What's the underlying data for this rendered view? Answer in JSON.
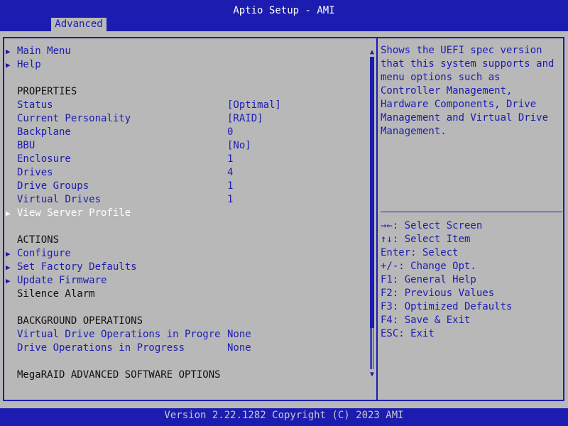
{
  "app_title": "Aptio Setup - AMI",
  "tab": "Advanced",
  "menu": {
    "main_menu": "Main Menu",
    "help": "Help",
    "properties_heading": "PROPERTIES",
    "status": {
      "label": "Status",
      "value": "[Optimal]"
    },
    "personality": {
      "label": "Current Personality",
      "value": "[RAID]"
    },
    "backplane": {
      "label": "Backplane",
      "value": "0"
    },
    "bbu": {
      "label": "BBU",
      "value": "[No]"
    },
    "enclosure": {
      "label": "Enclosure",
      "value": "1"
    },
    "drives": {
      "label": "Drives",
      "value": "4"
    },
    "drive_groups": {
      "label": "Drive Groups",
      "value": "1"
    },
    "virtual_drives": {
      "label": "Virtual Drives",
      "value": "1"
    },
    "view_server_profile": "View Server Profile",
    "actions_heading": "ACTIONS",
    "configure": "Configure",
    "set_factory_defaults": "Set Factory Defaults",
    "update_firmware": "Update Firmware",
    "silence_alarm": "Silence Alarm",
    "background_heading": "BACKGROUND OPERATIONS",
    "vd_ops": {
      "label": "Virtual Drive Operations in Progre",
      "value": "None"
    },
    "drive_ops": {
      "label": "Drive Operations in Progress",
      "value": "None"
    },
    "software_options_heading": "MegaRAID ADVANCED SOFTWARE OPTIONS"
  },
  "help_text": "Shows the UEFI spec version that this system supports and menu options such as Controller Management, Hardware Components, Drive Management and Virtual Drive Management.",
  "keys": [
    "→←: Select Screen",
    "↑↓: Select Item",
    "Enter: Select",
    "+/-: Change Opt.",
    "F1: General Help",
    "F2: Previous Values",
    "F3: Optimized Defaults",
    "F4: Save & Exit",
    "ESC: Exit"
  ],
  "footer": "Version 2.22.1282 Copyright (C) 2023 AMI",
  "colors": {
    "background": "#b8b8b8",
    "accent_blue": "#1c1cb0",
    "selected": "#ffffff"
  }
}
